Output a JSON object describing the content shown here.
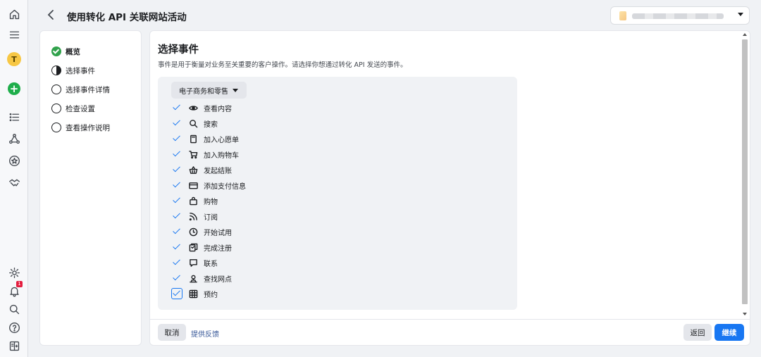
{
  "header": {
    "title": "使用转化 API 关联网站活动"
  },
  "rail": {
    "avatar_letter": "T",
    "add_label": "+",
    "notification_count": "1"
  },
  "steps": [
    {
      "label": "概览",
      "state": "done"
    },
    {
      "label": "选择事件",
      "state": "current"
    },
    {
      "label": "选择事件详情",
      "state": "todo"
    },
    {
      "label": "检查设置",
      "state": "todo"
    },
    {
      "label": "查看操作说明",
      "state": "todo"
    }
  ],
  "main": {
    "title": "选择事件",
    "description": "事件是用于衡量对业务至关重要的客户操作。请选择你想通过转化 API 发送的事件。",
    "category": "电子商务和零售",
    "events": [
      {
        "label": "查看内容",
        "icon": "eye-icon",
        "checked": true
      },
      {
        "label": "搜索",
        "icon": "search-icon",
        "checked": true
      },
      {
        "label": "加入心愿单",
        "icon": "wishlist-icon",
        "checked": true
      },
      {
        "label": "加入购物车",
        "icon": "cart-icon",
        "checked": true
      },
      {
        "label": "发起结账",
        "icon": "basket-icon",
        "checked": true
      },
      {
        "label": "添加支付信息",
        "icon": "credit-card-icon",
        "checked": true
      },
      {
        "label": "购物",
        "icon": "shopping-bag-icon",
        "checked": true
      },
      {
        "label": "订阅",
        "icon": "rss-icon",
        "checked": true
      },
      {
        "label": "开始试用",
        "icon": "clock-icon",
        "checked": true
      },
      {
        "label": "完成注册",
        "icon": "register-icon",
        "checked": true
      },
      {
        "label": "联系",
        "icon": "chat-icon",
        "checked": true
      },
      {
        "label": "查找网点",
        "icon": "location-icon",
        "checked": true
      },
      {
        "label": "预约",
        "icon": "calendar-grid-icon",
        "checked": true
      }
    ]
  },
  "footer": {
    "cancel": "取消",
    "feedback": "提供反馈",
    "back": "返回",
    "continue": "继续"
  },
  "colors": {
    "accent": "#1877f2",
    "done_green": "#31a24c",
    "add_green": "#1fae4b",
    "avatar_yellow": "#f7c744"
  }
}
